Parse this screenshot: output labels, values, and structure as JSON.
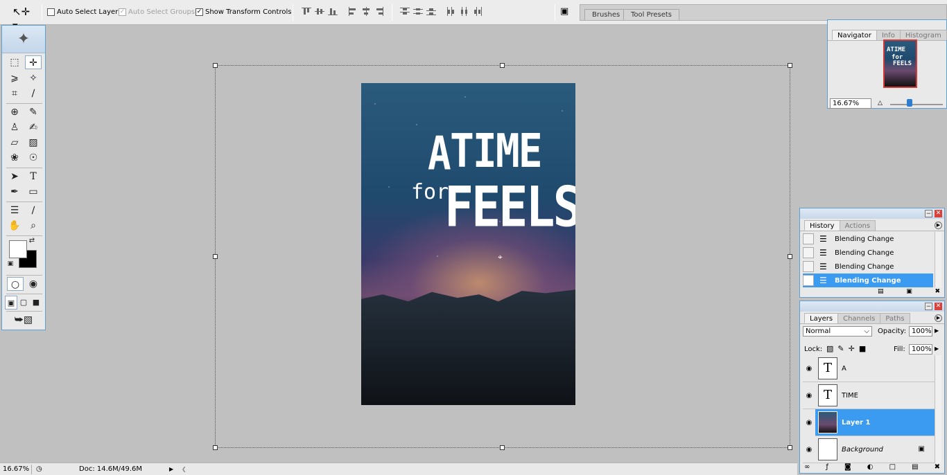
{
  "options_bar": {
    "tool_icon": "move-tool-icon",
    "auto_select_layer": {
      "label": "Auto Select Layer",
      "checked": false
    },
    "auto_select_groups": {
      "label": "Auto Select Groups",
      "checked": true,
      "enabled": false
    },
    "show_transform_controls": {
      "label": "Show Transform Controls",
      "checked": true
    }
  },
  "palette_well": {
    "tabs": [
      "Brushes",
      "Tool Presets"
    ]
  },
  "document": {
    "title_lines": [
      "A",
      "TIME",
      "for",
      "FEELS"
    ]
  },
  "navigator": {
    "tabs": [
      "Navigator",
      "Info",
      "Histogram"
    ],
    "zoom": "16.67%",
    "thumb_text": [
      "ATIME",
      "for",
      "FEELS"
    ]
  },
  "history": {
    "tabs": [
      "History",
      "Actions"
    ],
    "items": [
      {
        "label": "Blending Change",
        "selected": false
      },
      {
        "label": "Blending Change",
        "selected": false
      },
      {
        "label": "Blending Change",
        "selected": false
      },
      {
        "label": "Blending Change",
        "selected": true
      }
    ]
  },
  "layers": {
    "tabs": [
      "Layers",
      "Channels",
      "Paths"
    ],
    "blend_mode": "Normal",
    "opacity_label": "Opacity:",
    "opacity": "100%",
    "lock_label": "Lock:",
    "fill_label": "Fill:",
    "fill": "100%",
    "items": [
      {
        "name": "A",
        "type": "text",
        "selected": false
      },
      {
        "name": "TIME",
        "type": "text",
        "selected": false
      },
      {
        "name": "Layer 1",
        "type": "image",
        "selected": true
      },
      {
        "name": "Background",
        "type": "background",
        "selected": false
      }
    ]
  },
  "status_bar": {
    "zoom": "16.67%",
    "doc_info": "Doc: 14.6M/49.6M"
  },
  "colors": {
    "selection": "#3a9bf0",
    "panel_border": "#5fa0d3",
    "workspace": "#c0c0c0"
  }
}
